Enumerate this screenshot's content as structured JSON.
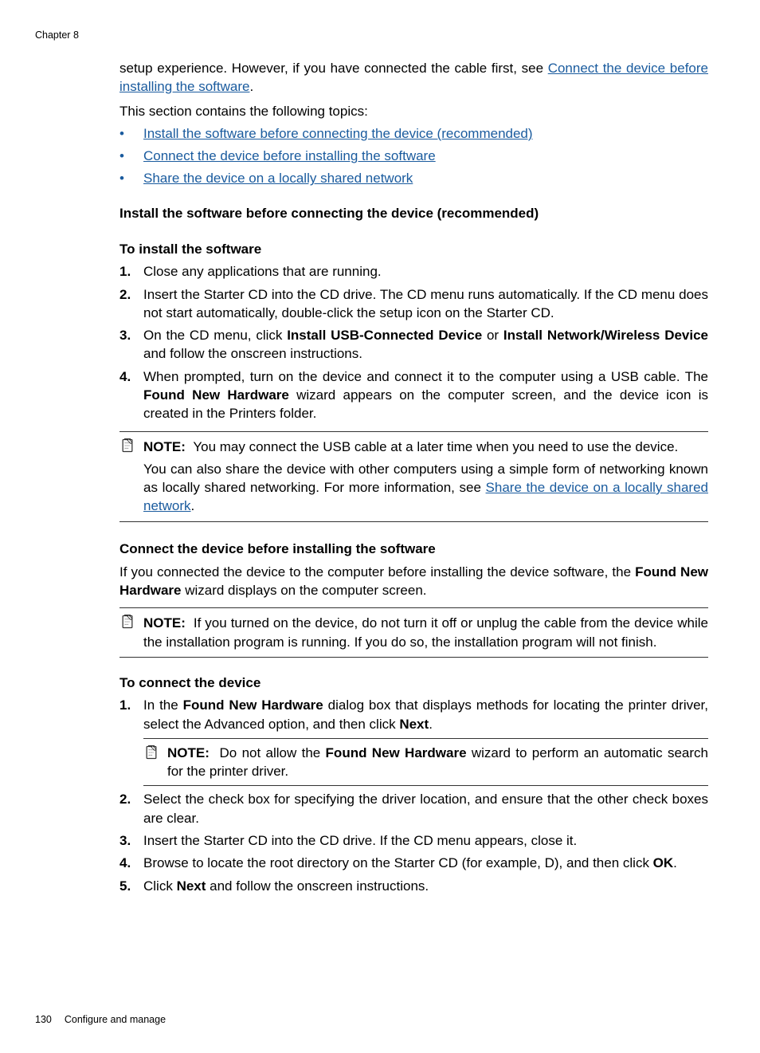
{
  "header": {
    "chapter": "Chapter 8"
  },
  "intro": {
    "para1_before_link": "setup experience. However, if you have connected the cable first, see ",
    "para1_link": "Connect the device before installing the software",
    "para1_after_link": ".",
    "para2": "This section contains the following topics:",
    "bullets": {
      "b1": "Install the software before connecting the device (recommended)",
      "b2": "Connect the device before installing the software",
      "b3": "Share the device on a locally shared network"
    }
  },
  "section1": {
    "heading": "Install the software before connecting the device (recommended)",
    "sub_heading": "To install the software",
    "steps": {
      "s1": "Close any applications that are running.",
      "s2": "Insert the Starter CD into the CD drive. The CD menu runs automatically. If the CD menu does not start automatically, double-click the setup icon on the Starter CD.",
      "s3_a": "On the CD menu, click ",
      "s3_b": "Install USB-Connected Device",
      "s3_c": " or ",
      "s3_d": "Install Network/Wireless Device",
      "s3_e": " and follow the onscreen instructions.",
      "s4_a": "When prompted, turn on the device and connect it to the computer using a USB cable. The ",
      "s4_b": "Found New Hardware",
      "s4_c": " wizard appears on the computer screen, and the device icon is created in the Printers folder."
    },
    "note_label": "NOTE:",
    "note1": "You may connect the USB cable at a later time when you need to use the device.",
    "note2_a": "You can also share the device with other computers using a simple form of networking known as locally shared networking. For more information, see ",
    "note2_link": "Share the device on a locally shared network",
    "note2_b": "."
  },
  "section2": {
    "heading": "Connect the device before installing the software",
    "intro_a": "If you connected the device to the computer before installing the device software, the ",
    "intro_b": "Found New Hardware",
    "intro_c": " wizard displays on the computer screen.",
    "note_label": "NOTE:",
    "note1": "If you turned on the device, do not turn it off or unplug the cable from the device while the installation program is running. If you do so, the installation program will not finish.",
    "sub_heading": "To connect the device",
    "steps": {
      "s1_a": "In the ",
      "s1_b": "Found New Hardware",
      "s1_c": " dialog box that displays methods for locating the printer driver, select the Advanced option, and then click ",
      "s1_d": "Next",
      "s1_e": ".",
      "s1_note_label": "NOTE:",
      "s1_note_a": "Do not allow the ",
      "s1_note_b": "Found New Hardware",
      "s1_note_c": " wizard to perform an automatic search for the printer driver.",
      "s2": "Select the check box for specifying the driver location, and ensure that the other check boxes are clear.",
      "s3": "Insert the Starter CD into the CD drive. If the CD menu appears, close it.",
      "s4_a": "Browse to locate the root directory on the Starter CD (for example, D), and then click ",
      "s4_b": "OK",
      "s4_c": ".",
      "s5_a": "Click ",
      "s5_b": "Next",
      "s5_c": " and follow the onscreen instructions."
    }
  },
  "footer": {
    "page": "130",
    "title": "Configure and manage"
  }
}
